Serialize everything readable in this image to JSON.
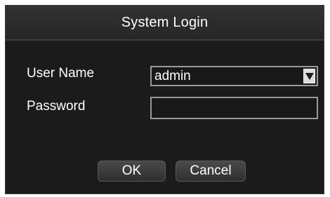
{
  "dialog": {
    "title": "System Login"
  },
  "form": {
    "username_label": "User Name",
    "username_value": "admin",
    "password_label": "Password",
    "password_value": ""
  },
  "buttons": {
    "ok_label": "OK",
    "cancel_label": "Cancel"
  },
  "icons": {
    "dropdown": "chevron-down-icon"
  },
  "colors": {
    "dialog_bg": "#1b1b1b",
    "titlebar_bg": "#2c2c2c",
    "text": "#ffffff",
    "field_border": "#9a9a9a"
  }
}
